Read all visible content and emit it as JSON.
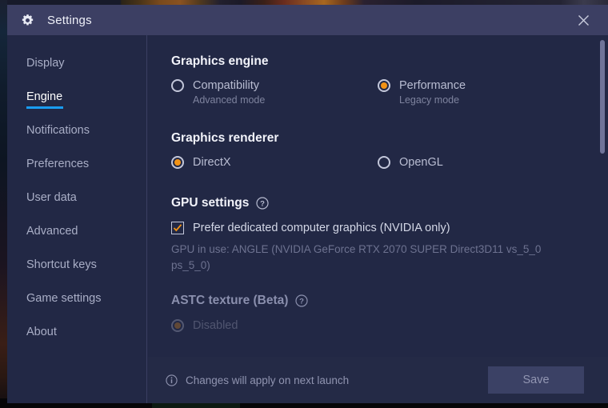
{
  "titlebar": {
    "icon": "gear-icon",
    "title": "Settings",
    "close_icon": "close-icon"
  },
  "sidebar": {
    "items": [
      {
        "label": "Display",
        "active": false
      },
      {
        "label": "Engine",
        "active": true
      },
      {
        "label": "Notifications",
        "active": false
      },
      {
        "label": "Preferences",
        "active": false
      },
      {
        "label": "User data",
        "active": false
      },
      {
        "label": "Advanced",
        "active": false
      },
      {
        "label": "Shortcut keys",
        "active": false
      },
      {
        "label": "Game settings",
        "active": false
      },
      {
        "label": "About",
        "active": false
      }
    ]
  },
  "content": {
    "graphics_engine": {
      "title": "Graphics engine",
      "options": [
        {
          "label": "Compatibility",
          "sub": "Advanced mode",
          "selected": false
        },
        {
          "label": "Performance",
          "sub": "Legacy mode",
          "selected": true
        }
      ]
    },
    "graphics_renderer": {
      "title": "Graphics renderer",
      "options": [
        {
          "label": "DirectX",
          "selected": true
        },
        {
          "label": "OpenGL",
          "selected": false
        }
      ]
    },
    "gpu_settings": {
      "title": "GPU settings",
      "help_icon": "help-circle-icon",
      "checkbox": {
        "label": "Prefer dedicated computer graphics (NVIDIA only)",
        "checked": true
      },
      "gpu_in_use": "GPU in use: ANGLE (NVIDIA GeForce RTX 2070 SUPER Direct3D11 vs_5_0 ps_5_0)"
    },
    "astc_texture": {
      "title": "ASTC texture (Beta)",
      "help_icon": "help-circle-icon",
      "options": [
        {
          "label": "Disabled",
          "selected": true
        }
      ]
    }
  },
  "footer": {
    "info_icon": "info-circle-icon",
    "note": "Changes will apply on next launch",
    "save_label": "Save"
  },
  "colors": {
    "accent_orange": "#f29316",
    "accent_blue": "#1a9cf0",
    "dialog_bg": "#222845",
    "titlebar_bg": "#3c3f63",
    "save_bg": "#3b4165"
  }
}
